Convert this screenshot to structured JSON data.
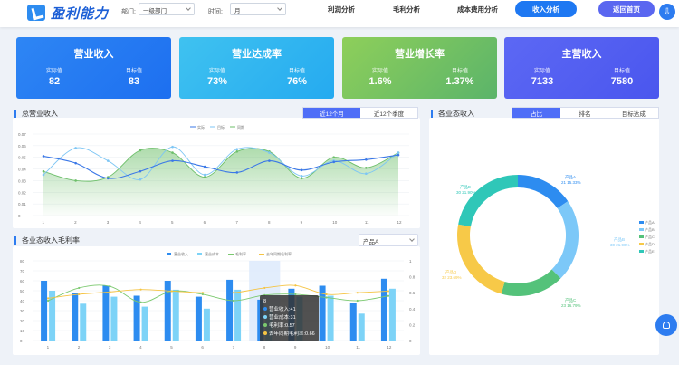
{
  "header": {
    "logo_text": "盈利能力",
    "dept_label": "部门:",
    "dept_value": "一级部门",
    "time_label": "时间:",
    "time_value": "月",
    "nav": [
      "利润分析",
      "毛利分析",
      "成本费用分析"
    ],
    "active_nav": "收入分析",
    "back_button": "返回首页"
  },
  "kpis": [
    {
      "title": "营业收入",
      "actual_label": "实际值",
      "actual": "82",
      "target_label": "目标值",
      "target": "83",
      "color_from": "#2e86f4",
      "color_to": "#1d6ff0"
    },
    {
      "title": "营业达成率",
      "actual_label": "实际值",
      "actual": "73%",
      "target_label": "目标值",
      "target": "76%",
      "color_from": "#3fc2f0",
      "color_to": "#25aaf0"
    },
    {
      "title": "营业增长率",
      "actual_label": "实际值",
      "actual": "1.6%",
      "target_label": "目标值",
      "target": "1.37%",
      "color_from": "#8ecf5a",
      "color_to": "#5bb46a"
    },
    {
      "title": "主营收入",
      "actual_label": "实际值",
      "actual": "7133",
      "target_label": "目标值",
      "target": "7580",
      "color_from": "#5c68f4",
      "color_to": "#4a56ee"
    }
  ],
  "total_revenue": {
    "title": "总营业收入",
    "tabs": [
      "近12个月",
      "近12个季度"
    ],
    "active_tab": 0,
    "legend": [
      "实际",
      "目标",
      "同期"
    ]
  },
  "business_revenue": {
    "title": "各业态收入",
    "tabs": [
      "占比",
      "排名",
      "目标达成"
    ],
    "active_tab": 0,
    "legend": [
      "产品A",
      "产品B",
      "产品C",
      "产品D",
      "产品E"
    ]
  },
  "margin": {
    "title": "各业态收入毛利率",
    "select_value": "产品A",
    "legend": [
      "营业收入",
      "营业成本",
      "毛利率",
      "去年同期毛利率"
    ],
    "tooltip": {
      "title": "8",
      "rows": [
        "营业收入:41",
        "营业成本:31",
        "毛利率:0.57",
        "去年同期毛利率:0.66"
      ]
    }
  },
  "chart_data": [
    {
      "type": "line",
      "x": [
        1,
        2,
        3,
        4,
        5,
        6,
        7,
        8,
        9,
        10,
        11,
        12
      ],
      "ylim": [
        0,
        0.07
      ],
      "yticks": [
        "0.07",
        "0.06",
        "0.05",
        "0.04",
        "0.03",
        "0.02",
        "0.01",
        "0"
      ],
      "series": [
        {
          "name": "实际",
          "values": [
            0.051,
            0.045,
            0.032,
            0.038,
            0.047,
            0.042,
            0.037,
            0.047,
            0.039,
            0.046,
            0.048,
            0.052
          ],
          "color": "#3b78e7"
        },
        {
          "name": "目标",
          "values": [
            0.035,
            0.058,
            0.047,
            0.031,
            0.059,
            0.035,
            0.057,
            0.054,
            0.034,
            0.047,
            0.036,
            0.054
          ],
          "color": "#7ec6f4"
        },
        {
          "name": "同期",
          "values": [
            0.038,
            0.03,
            0.033,
            0.056,
            0.054,
            0.033,
            0.055,
            0.055,
            0.032,
            0.05,
            0.041,
            0.054
          ],
          "color": "#6dbf6a"
        }
      ]
    },
    {
      "type": "pie",
      "categories": [
        "产品A",
        "产品B",
        "产品C",
        "产品D",
        "产品E"
      ],
      "values": [
        21,
        30,
        23,
        32,
        30
      ],
      "labels": [
        "21 15.33%",
        "30 21.90%",
        "23 16.79%",
        "32 23.69%",
        "30 21.90%"
      ],
      "colors": [
        "#2d8cf0",
        "#7cc8f8",
        "#54c27a",
        "#f7c948",
        "#2fc7b8"
      ]
    },
    {
      "type": "bar",
      "categories": [
        "1",
        "2",
        "3",
        "4",
        "5",
        "6",
        "7",
        "8",
        "9",
        "10",
        "11",
        "12"
      ],
      "ylim": [
        0,
        80
      ],
      "yticks": [
        "80",
        "70",
        "60",
        "50",
        "40",
        "30",
        "20",
        "10",
        "0"
      ],
      "y2ticks": [
        "1",
        "0.8",
        "0.6",
        "0.4",
        "0.2",
        "0"
      ],
      "series": [
        {
          "name": "营业收入",
          "values": [
            60,
            48,
            55,
            45,
            60,
            44,
            61,
            41,
            52,
            55,
            38,
            62
          ],
          "color": "#2d8cf0"
        },
        {
          "name": "营业成本",
          "values": [
            50,
            37,
            44,
            34,
            51,
            32,
            51,
            31,
            44,
            45,
            27,
            52
          ],
          "color": "#7dd3f7"
        },
        {
          "name": "毛利率",
          "values": [
            0.5,
            0.66,
            0.68,
            0.48,
            0.62,
            0.58,
            0.5,
            0.57,
            0.58,
            0.54,
            0.5,
            0.56
          ],
          "color": "#7bc96f"
        },
        {
          "name": "去年同期毛利率",
          "values": [
            0.53,
            0.58,
            0.61,
            0.64,
            0.62,
            0.6,
            0.6,
            0.66,
            0.69,
            0.58,
            0.6,
            0.62
          ],
          "color": "#f5c443"
        }
      ],
      "highlight_index": 7
    }
  ]
}
